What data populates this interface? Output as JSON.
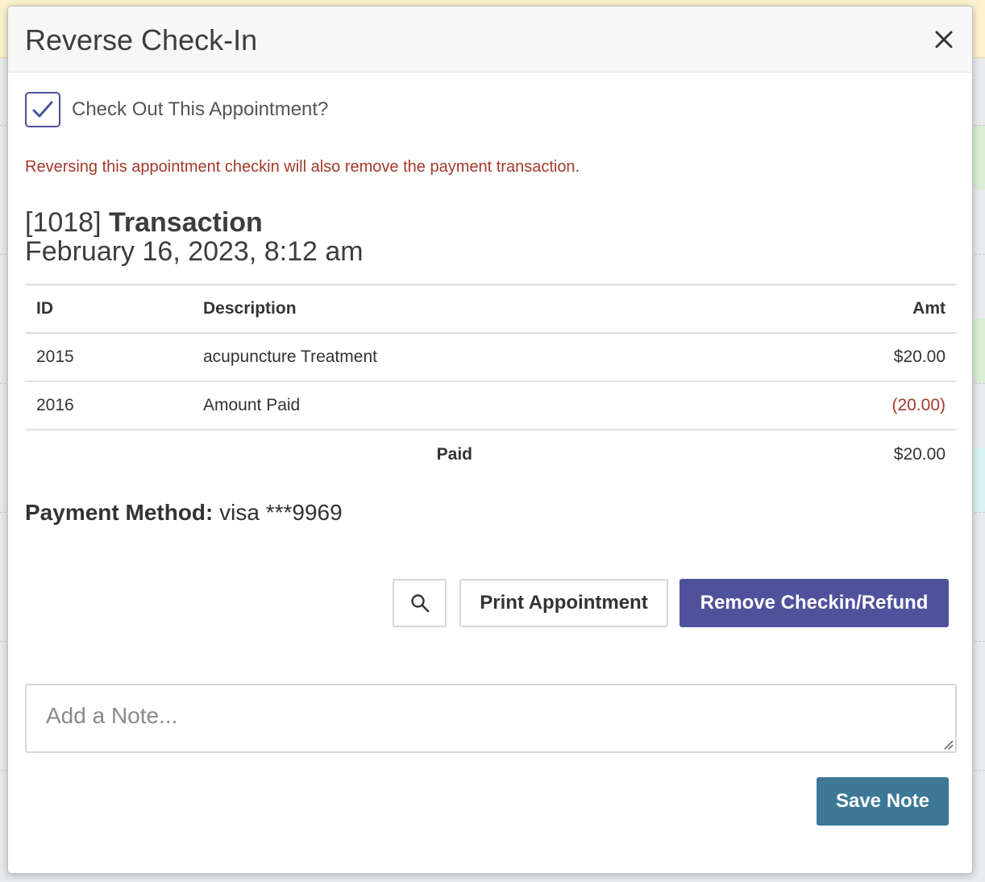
{
  "colors": {
    "primary": "#4f529b",
    "save": "#3d7896",
    "warning_text": "#a33a2a",
    "negative_amount": "#a33a2a"
  },
  "modal": {
    "title": "Reverse Check-In",
    "close_icon": "close-icon"
  },
  "checkout": {
    "checked": true,
    "label": "Check Out This Appointment?"
  },
  "warning": "Reversing this appointment checkin will also remove the payment transaction.",
  "transaction": {
    "id_text": "[1018]",
    "word": "Transaction",
    "date": "February 16, 2023, 8:12 am"
  },
  "table": {
    "headers": {
      "id": "ID",
      "description": "Description",
      "amount": "Amt"
    },
    "rows": [
      {
        "id": "2015",
        "description": "acupuncture Treatment",
        "amount": "$20.00",
        "negative": false
      },
      {
        "id": "2016",
        "description": "Amount Paid",
        "amount": "(20.00)",
        "negative": true
      }
    ],
    "footer": {
      "label": "Paid",
      "amount": "$20.00"
    }
  },
  "payment": {
    "label": "Payment Method:",
    "value": "visa ***9969"
  },
  "actions": {
    "search_icon": "search-icon",
    "print_label": "Print Appointment",
    "remove_label": "Remove Checkin/Refund"
  },
  "note": {
    "placeholder": "Add a Note...",
    "value": "",
    "save_label": "Save Note"
  }
}
